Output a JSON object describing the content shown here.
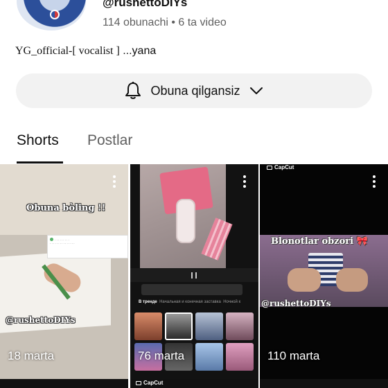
{
  "channel": {
    "handle": "@rushettoDIYs",
    "stats": "114 obunachi • 6 ta video",
    "description": "YG_official-[ vocalist ]",
    "description_more": " ...yana"
  },
  "subscribe": {
    "label": "Obuna qilgansiz"
  },
  "tabs": [
    {
      "label": "Shorts",
      "active": true
    },
    {
      "label": "Postlar",
      "active": false
    }
  ],
  "shorts": [
    {
      "views": "18 marta",
      "overlay_title": "Obuna bòling !!",
      "watermark": "@rushettoDIYs"
    },
    {
      "views": "76 marta",
      "app_tabs": [
        "В тренде",
        "Начальная и конечная заставка",
        "Ночной к"
      ]
    },
    {
      "views": "110 marta",
      "badge": "CapCut",
      "overlay_title": "Blonotlar obzori",
      "bow": "🎀",
      "watermark": "@rushettoDIYs"
    }
  ],
  "next_row_badges": [
    "CapCut"
  ],
  "colors": {
    "button_bg": "#f2f2f2",
    "text_primary": "#0f0f0f",
    "text_secondary": "#606060"
  }
}
